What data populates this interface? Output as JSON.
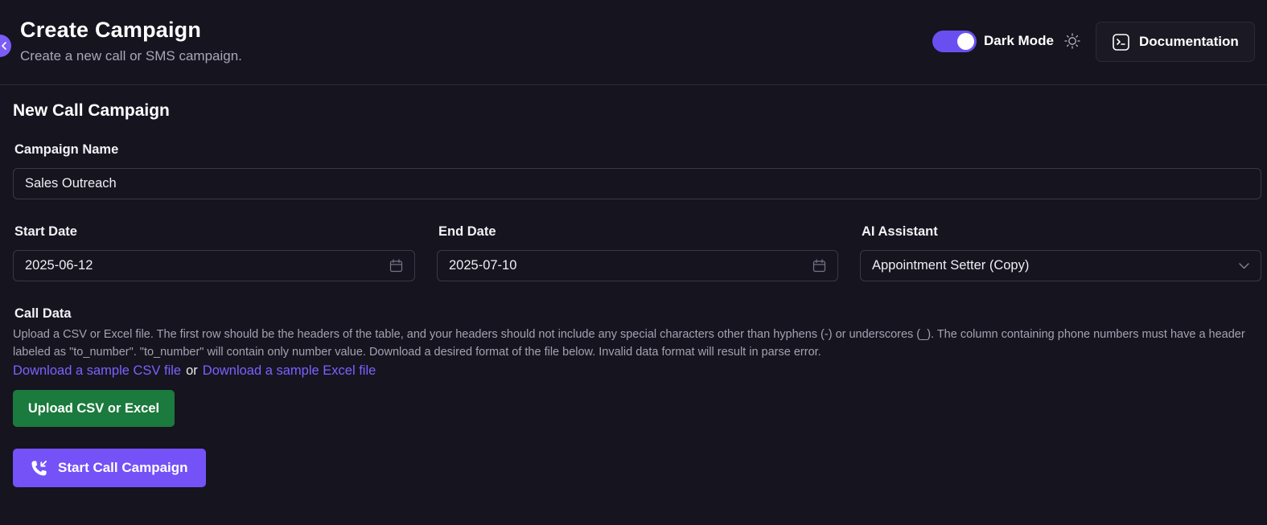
{
  "header": {
    "title": "Create Campaign",
    "subtitle": "Create a new call or SMS campaign.",
    "dark_mode_label": "Dark Mode",
    "dark_mode_on": true,
    "documentation_label": "Documentation"
  },
  "form": {
    "section_title": "New Call Campaign",
    "campaign_name": {
      "label": "Campaign Name",
      "value": "Sales Outreach"
    },
    "start_date": {
      "label": "Start Date",
      "value": "2025-06-12"
    },
    "end_date": {
      "label": "End Date",
      "value": "2025-07-10"
    },
    "ai_assistant": {
      "label": "AI Assistant",
      "value": "Appointment Setter (Copy)"
    },
    "call_data": {
      "label": "Call Data",
      "help": "Upload a CSV or Excel file. The first row should be the headers of the table, and your headers should not include any special characters other than hyphens (-) or underscores (_). The column containing phone numbers must have a header labeled as \"to_number\". \"to_number\" will contain only number value. Download a desired format of the file below. Invalid data format will result in parse error.",
      "csv_link": "Download a sample CSV file",
      "or_text": "or",
      "excel_link": "Download a sample Excel file"
    },
    "upload_button": "Upload CSV or Excel",
    "start_button": "Start Call Campaign"
  },
  "colors": {
    "background": "#16141f",
    "accent": "#7452f7",
    "upload_green": "#1b7a3d",
    "link": "#7b62ff"
  },
  "icons": [
    "chevron-left-icon",
    "sun-icon",
    "terminal-icon",
    "calendar-icon",
    "chevron-down-icon",
    "phone-incoming-icon"
  ]
}
